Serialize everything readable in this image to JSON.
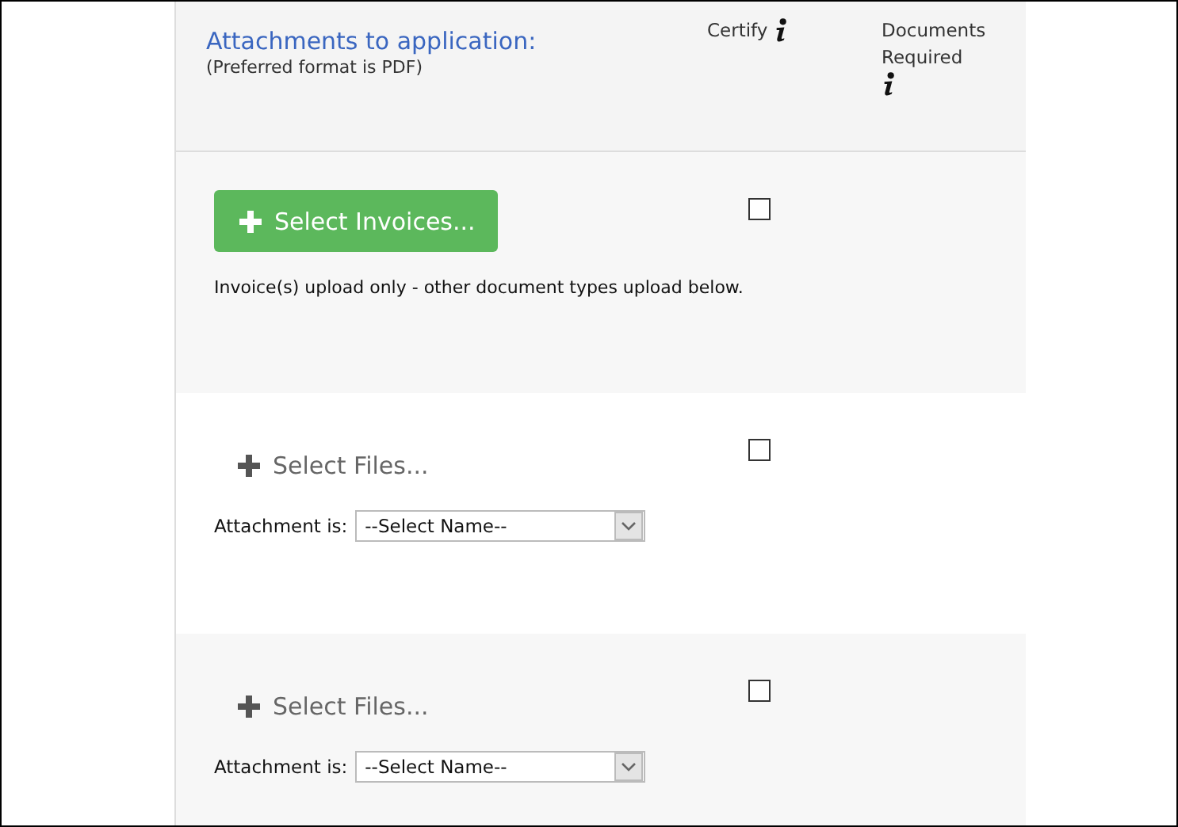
{
  "header": {
    "title": "Attachments to application:",
    "subtitle": "(Preferred format is PDF)",
    "columns": [
      {
        "label": "Certify"
      },
      {
        "label": "Documents Required"
      }
    ]
  },
  "rows": [
    {
      "kind": "invoice",
      "button": "Select Invoices...",
      "note": "Invoice(s) upload only - other document types upload below.",
      "certified": false
    },
    {
      "kind": "files",
      "button": "Select Files...",
      "attachment_label": "Attachment is:",
      "select_value": "--Select Name--",
      "certified": false
    },
    {
      "kind": "files",
      "button": "Select Files...",
      "attachment_label": "Attachment is:",
      "select_value": "--Select Name--",
      "certified": false
    }
  ]
}
